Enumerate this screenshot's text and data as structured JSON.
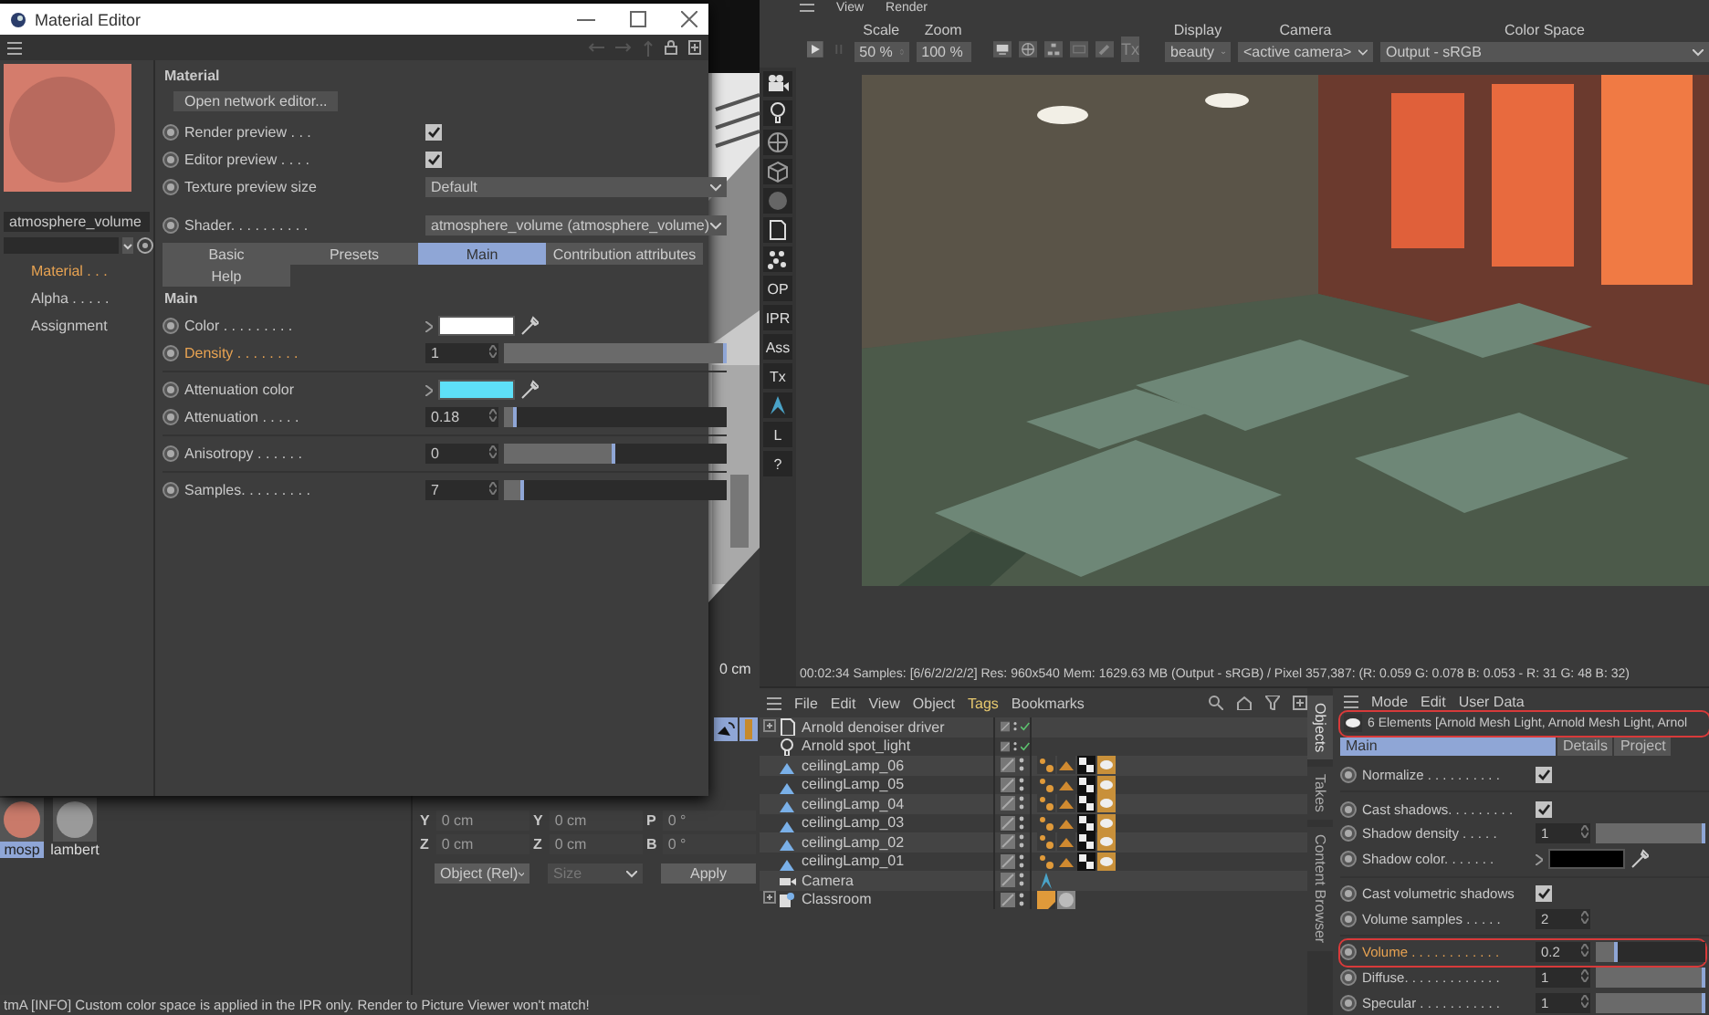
{
  "material_editor": {
    "title": "Material Editor",
    "material_name": "atmosphere_volume",
    "nav": [
      {
        "label": "Material . . .",
        "selected": true
      },
      {
        "label": "Alpha . . . . .",
        "selected": false
      },
      {
        "label": "Assignment",
        "selected": false
      }
    ],
    "section_title": "Material",
    "network_button": "Open network editor...",
    "options": [
      {
        "kind": "checkbox",
        "label": "Render preview . . .",
        "checked": true
      },
      {
        "kind": "checkbox",
        "label": "Editor preview . . . .",
        "checked": true
      },
      {
        "kind": "dropdown",
        "label": "Texture preview size",
        "value": "Default"
      },
      {
        "kind": "dropdown",
        "label": "Shader. . . . . . . . . .",
        "value": "atmosphere_volume (atmosphere_volume)"
      }
    ],
    "tabs": [
      {
        "label": "Basic",
        "selected": false
      },
      {
        "label": "Presets",
        "selected": false
      },
      {
        "label": "Main",
        "selected": true
      },
      {
        "label": "Contribution attributes",
        "selected": false
      },
      {
        "label": "Help",
        "selected": false
      }
    ],
    "group_title": "Main",
    "params": [
      {
        "kind": "color",
        "label": "Color . . . . . . . . .",
        "color": "#ffffff",
        "highlighted": false
      },
      {
        "kind": "slider",
        "label": "Density . . . . . . . .",
        "value": "1",
        "level": 1,
        "highlighted": true
      },
      {
        "kind": "color",
        "label": "Attenuation color",
        "color": "#5ee0f8",
        "highlighted": false
      },
      {
        "kind": "slider",
        "label": "Attenuation . . . . .",
        "value": "0.18",
        "level": 0.06,
        "highlighted": false
      },
      {
        "kind": "slider",
        "label": "Anisotropy . . . . . .",
        "value": "0",
        "level": 0.5,
        "highlighted": false
      },
      {
        "kind": "slider",
        "label": "Samples. . . . . . . . .",
        "value": "7",
        "level": 0.09,
        "highlighted": false
      }
    ]
  },
  "viewport": {
    "label": "0 cm"
  },
  "render_view": {
    "menu": [
      "View",
      "Render"
    ],
    "scale": {
      "label": "Scale",
      "value": "50 %"
    },
    "zoom": {
      "label": "Zoom",
      "value": "100 %"
    },
    "display": {
      "label": "Display",
      "value": "beauty"
    },
    "camera": {
      "label": "Camera",
      "value": "<active camera>"
    },
    "color_space": {
      "label": "Color Space",
      "value": "Output - sRGB"
    },
    "texture_button": "Tx",
    "side_tools": [
      {
        "kind": "camera"
      },
      {
        "kind": "bulb"
      },
      {
        "kind": "globe"
      },
      {
        "kind": "cube"
      },
      {
        "kind": "sphere"
      },
      {
        "kind": "page"
      },
      {
        "kind": "dots"
      },
      {
        "kind": "text",
        "label": "OP"
      },
      {
        "kind": "text",
        "label": "IPR"
      },
      {
        "kind": "text",
        "label": "Ass"
      },
      {
        "kind": "text",
        "label": "Tx"
      },
      {
        "kind": "arnold"
      },
      {
        "kind": "text",
        "label": "L"
      },
      {
        "kind": "text",
        "label": "?"
      }
    ],
    "status": "00:02:34  Samples: [6/6/2/2/2/2]  Res: 960x540  Mem: 1629.63 MB  (Output - sRGB) / Pixel 357,387: (R: 0.059 G: 0.078 B: 0.053 - R: 31 G: 48 B: 32)"
  },
  "object_manager": {
    "menu": [
      {
        "label": "File",
        "highlighted": false
      },
      {
        "label": "Edit",
        "highlighted": false
      },
      {
        "label": "View",
        "highlighted": false
      },
      {
        "label": "Object",
        "highlighted": false
      },
      {
        "label": "Tags",
        "highlighted": true
      },
      {
        "label": "Bookmarks",
        "highlighted": false
      }
    ],
    "objects": [
      {
        "name": "Arnold denoiser driver",
        "kind": "driver",
        "expandable": true,
        "render_check": true
      },
      {
        "name": "Arnold spot_light",
        "kind": "spot",
        "expandable": false,
        "render_check": true
      },
      {
        "name": "ceilingLamp_06",
        "kind": "lamp",
        "expandable": false,
        "render_check": false,
        "tags": [
          {
            "kind": "vertex"
          },
          {
            "kind": "hair"
          },
          {
            "kind": "checker"
          },
          {
            "kind": "meshlight"
          }
        ]
      },
      {
        "name": "ceilingLamp_05",
        "kind": "lamp",
        "expandable": false,
        "render_check": false,
        "tags": [
          {
            "kind": "vertex"
          },
          {
            "kind": "hair"
          },
          {
            "kind": "checker"
          },
          {
            "kind": "meshlight"
          }
        ]
      },
      {
        "name": "ceilingLamp_04",
        "kind": "lamp",
        "expandable": false,
        "render_check": false,
        "tags": [
          {
            "kind": "vertex"
          },
          {
            "kind": "hair"
          },
          {
            "kind": "checker"
          },
          {
            "kind": "meshlight"
          }
        ]
      },
      {
        "name": "ceilingLamp_03",
        "kind": "lamp",
        "expandable": false,
        "render_check": false,
        "tags": [
          {
            "kind": "vertex"
          },
          {
            "kind": "hair"
          },
          {
            "kind": "checker"
          },
          {
            "kind": "meshlight"
          }
        ]
      },
      {
        "name": "ceilingLamp_02",
        "kind": "lamp",
        "expandable": false,
        "render_check": false,
        "tags": [
          {
            "kind": "vertex"
          },
          {
            "kind": "hair"
          },
          {
            "kind": "checker"
          },
          {
            "kind": "meshlight"
          }
        ]
      },
      {
        "name": "ceilingLamp_01",
        "kind": "lamp",
        "expandable": false,
        "render_check": false,
        "tags": [
          {
            "kind": "vertex"
          },
          {
            "kind": "hair"
          },
          {
            "kind": "checker"
          },
          {
            "kind": "meshlight"
          }
        ]
      },
      {
        "name": "Camera",
        "kind": "camera",
        "expandable": false,
        "render_check": false,
        "tags": [
          {
            "kind": "arnold"
          }
        ]
      },
      {
        "name": "Classroom",
        "kind": "null",
        "expandable": true,
        "render_check": false,
        "tags": [
          {
            "kind": "phong"
          },
          {
            "kind": "material"
          }
        ]
      }
    ]
  },
  "side_tabs": [
    {
      "label": "Objects",
      "selected": true
    },
    {
      "label": "Takes",
      "selected": false
    },
    {
      "label": "Content Browser",
      "selected": false
    }
  ],
  "attribute_manager": {
    "menu": [
      "Mode",
      "Edit",
      "User Data"
    ],
    "header": "6 Elements [Arnold Mesh Light, Arnold Mesh Light, Arnol",
    "header_outlined": true,
    "tabs": [
      {
        "label": "Main",
        "selected": true
      },
      {
        "label": "Details",
        "selected": false
      },
      {
        "label": "Project",
        "selected": false
      }
    ],
    "params": [
      {
        "kind": "checkbox",
        "label": "Normalize . . . . . . . . . .",
        "checked": true,
        "highlighted": false,
        "outlined": false
      },
      {
        "kind": "checkbox",
        "label": "Cast shadows. . . . . . . . .",
        "checked": true,
        "highlighted": false,
        "outlined": false
      },
      {
        "kind": "slider",
        "label": "Shadow density . . . . .",
        "value": "1",
        "level": 1,
        "highlighted": false,
        "outlined": false
      },
      {
        "kind": "color",
        "label": "Shadow color. . . . . . .",
        "color": "#000000",
        "highlighted": false,
        "outlined": false
      },
      {
        "kind": "checkbox",
        "label": "Cast volumetric shadows",
        "checked": true,
        "highlighted": false,
        "outlined": false
      },
      {
        "kind": "number",
        "label": "Volume samples . . . . .",
        "value": "2",
        "highlighted": false,
        "outlined": false
      },
      {
        "kind": "slider",
        "label": "Volume . . . . . . . . . . . .",
        "value": "0.2",
        "level": 0.2,
        "highlighted": true,
        "outlined": true
      },
      {
        "kind": "slider",
        "label": "Diffuse. . . . . . . . . . . . .",
        "value": "1",
        "level": 1,
        "highlighted": false,
        "outlined": false
      },
      {
        "kind": "slider",
        "label": "Specular . . . . . . . . . . .",
        "value": "1",
        "level": 1,
        "highlighted": false,
        "outlined": false
      }
    ]
  },
  "material_bin": [
    {
      "name": "mosp",
      "kind": "volume",
      "selected": true
    },
    {
      "name": "lambert",
      "kind": "lambert",
      "selected": false
    }
  ],
  "coordinates": {
    "rows": [
      [
        "Y",
        "0 cm",
        "Y",
        "0 cm",
        "P",
        "0 °"
      ],
      [
        "Z",
        "0 cm",
        "Z",
        "0 cm",
        "B",
        "0 °"
      ]
    ],
    "mode": "Object (Rel)",
    "size": "Size",
    "apply": "Apply"
  },
  "status_bar": "tmA  [INFO] Custom color space is applied in the IPR only. Render to Picture Viewer won't match!"
}
